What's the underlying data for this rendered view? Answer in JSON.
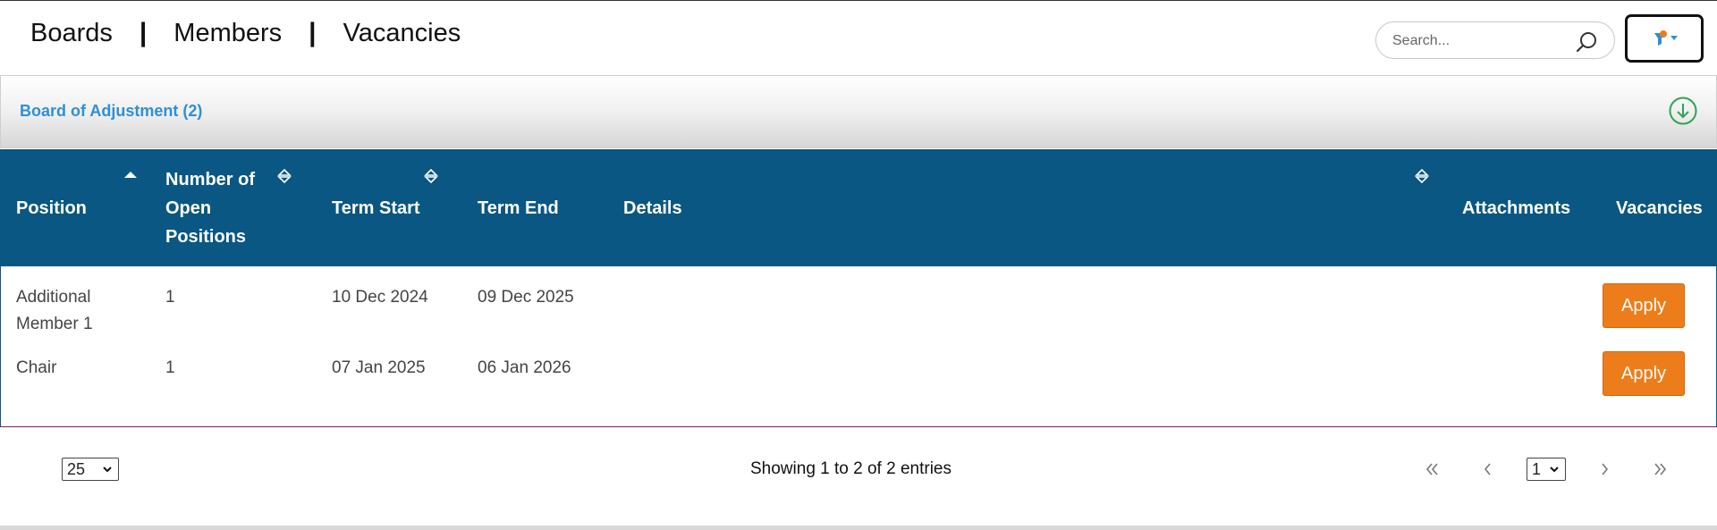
{
  "nav": {
    "boards": "Boards",
    "members": "Members",
    "vacancies": "Vacancies",
    "separator": "|"
  },
  "search": {
    "placeholder": "Search..."
  },
  "panel": {
    "title": "Board of Adjustment (2)"
  },
  "table": {
    "headers": {
      "position": [
        "Position"
      ],
      "open_positions": [
        "Number of",
        "Open",
        "Positions"
      ],
      "term_start": [
        "Term Start"
      ],
      "term_end": [
        "Term End"
      ],
      "details": [
        "Details"
      ],
      "attachments": [
        "Attachments"
      ],
      "vacancies": [
        "Vacancies"
      ]
    },
    "rows": [
      {
        "position": [
          "Additional",
          "Member 1"
        ],
        "open": "1",
        "term_start": "10 Dec 2024",
        "term_end": "09 Dec 2025",
        "action": "Apply"
      },
      {
        "position": [
          "Chair"
        ],
        "open": "1",
        "term_start": "07 Jan 2025",
        "term_end": "06 Jan 2026",
        "action": "Apply"
      }
    ]
  },
  "pager": {
    "page_size": "25",
    "info": "Showing 1 to 2 of 2 entries",
    "current_page": "1"
  },
  "colors": {
    "header_bg": "#0b5783",
    "apply_bg": "#ec7d1a",
    "panel_title": "#2f8fd6",
    "download_icon": "#2ea44f",
    "filter_dot": "#ec7d1a",
    "filter_icon": "#2f8fd6"
  },
  "icons": {
    "search": "search-icon",
    "filter": "filter-icon",
    "download": "download-circle-icon",
    "sort": "sort-icon",
    "first": "first-page-icon",
    "prev": "prev-page-icon",
    "next": "next-page-icon",
    "last": "last-page-icon"
  }
}
